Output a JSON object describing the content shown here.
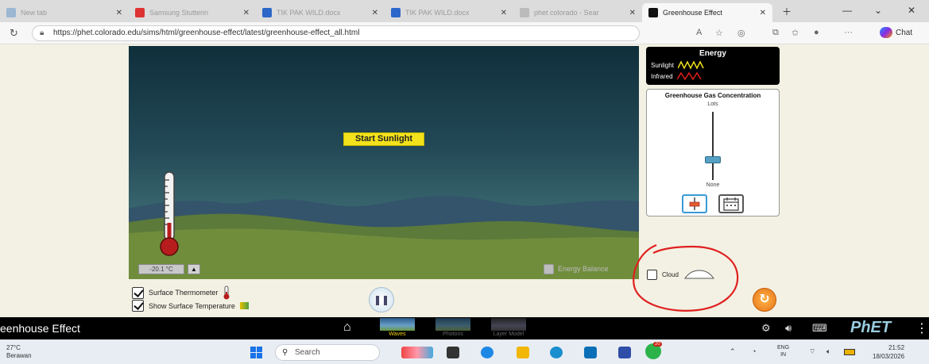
{
  "browser": {
    "tabs": [
      {
        "label": "New tab",
        "active": false
      },
      {
        "label": "Samsung Stutterin",
        "active": false
      },
      {
        "label": "TIK PAK WILD.docx",
        "active": false
      },
      {
        "label": "TIK PAK WILD.docx",
        "active": false
      },
      {
        "label": "phet colorado - Sear",
        "active": false
      },
      {
        "label": "Greenhouse Effect",
        "active": true
      }
    ],
    "url": "https://phet.colorado.edu/sims/html/greenhouse-effect/latest/greenhouse-effect_all.html",
    "chat_label": "Chat"
  },
  "sim": {
    "start_sunlight_label": "Start Sunlight",
    "thermometer_readout": "-20.1 °C",
    "energy_balance_label": "Energy Balance",
    "energy_legend": {
      "title": "Energy",
      "sunlight_label": "Sunlight",
      "infrared_label": "Infrared",
      "sunlight_color": "#f2e21b",
      "infrared_color": "#e0201c"
    },
    "concentration": {
      "title": "Greenhouse Gas Concentration",
      "top_label": "Lots",
      "bottom_label": "None",
      "level_fraction": 0.3
    },
    "cloud_label": "Cloud",
    "surface_thermometer_label": "Surface Thermometer",
    "show_surface_temp_label": "Show Surface Temperature"
  },
  "phet_bar": {
    "sim_title": "eenhouse Effect",
    "screens": [
      {
        "label": "Waves",
        "active": true
      },
      {
        "label": "Photons",
        "active": false
      },
      {
        "label": "Layer Model",
        "active": false
      }
    ],
    "logo_ph": "PhET"
  },
  "taskbar": {
    "weather_temp": "27°C",
    "weather_desc": "Berawan",
    "search_placeholder": "Search",
    "lang_top": "ENG",
    "lang_bottom": "IN",
    "time": "21:52",
    "date": "18/03/2026",
    "badge": "20"
  },
  "annotation_color": "#e02020"
}
